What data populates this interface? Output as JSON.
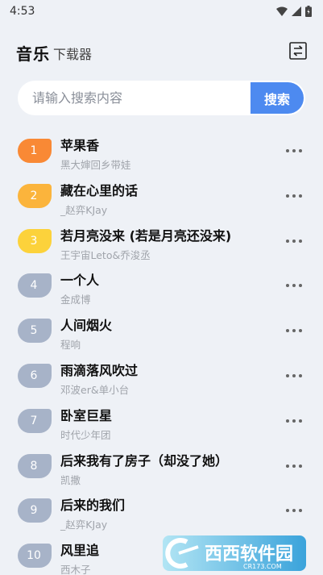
{
  "status_bar": {
    "time": "4:53"
  },
  "header": {
    "title": "音乐",
    "subtitle": "下载器"
  },
  "search": {
    "placeholder": "请输入搜索内容",
    "button_label": "搜索"
  },
  "songs": [
    {
      "rank": "1",
      "title": "苹果香",
      "artist": "黑大婶回乡带娃",
      "badge_color": "#f98935"
    },
    {
      "rank": "2",
      "title": "藏在心里的话",
      "artist": "_赵弈KJay",
      "badge_color": "#fbb43c"
    },
    {
      "rank": "3",
      "title": "若月亮没来 (若是月亮还没来)",
      "artist": "王宇宙Leto&乔浚丞",
      "badge_color": "#fcd23b"
    },
    {
      "rank": "4",
      "title": "一个人",
      "artist": "金成博",
      "badge_color": "#a7b3c8"
    },
    {
      "rank": "5",
      "title": "人间烟火",
      "artist": "程响",
      "badge_color": "#a7b3c8"
    },
    {
      "rank": "6",
      "title": "雨滴落风吹过",
      "artist": "邓波er&单小台",
      "badge_color": "#a7b3c8"
    },
    {
      "rank": "7",
      "title": "卧室巨星",
      "artist": "时代少年团",
      "badge_color": "#a7b3c8"
    },
    {
      "rank": "8",
      "title": "后来我有了房子（却没了她）",
      "artist": "凯撒",
      "badge_color": "#a7b3c8"
    },
    {
      "rank": "9",
      "title": "后来的我们",
      "artist": "_赵弈KJay",
      "badge_color": "#a7b3c8"
    },
    {
      "rank": "10",
      "title": "风里追",
      "artist": "西木子",
      "badge_color": "#a7b3c8"
    }
  ],
  "watermark": {
    "text": "西西软件园",
    "domain": "CR173.COM"
  }
}
